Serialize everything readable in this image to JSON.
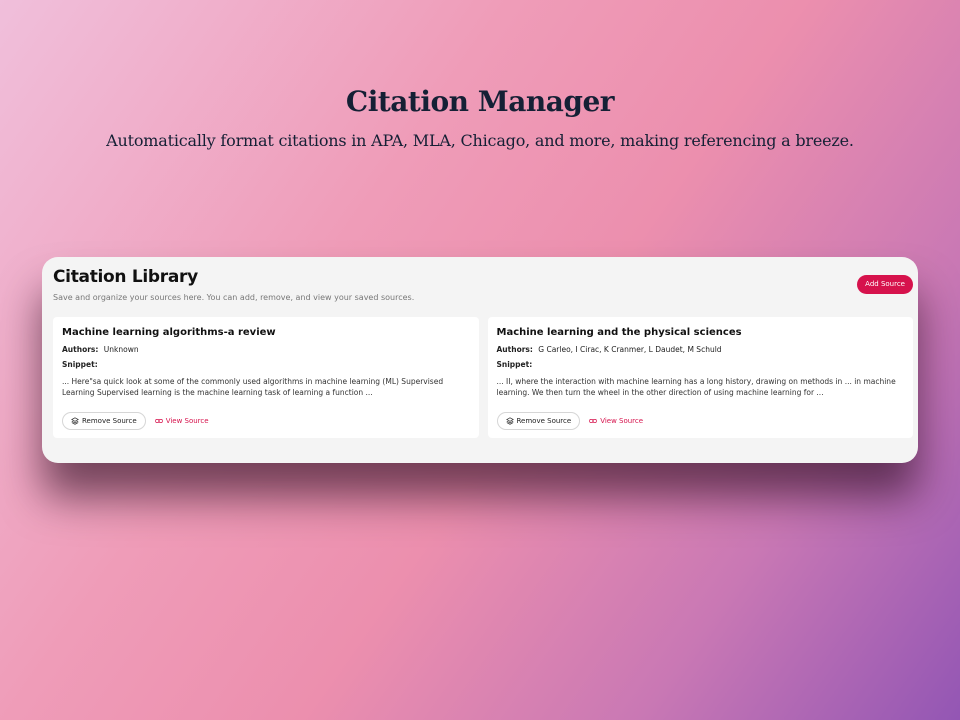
{
  "hero": {
    "title": "Citation Manager",
    "subtitle": "Automatically format citations in APA, MLA, Chicago, and more, making referencing a breeze."
  },
  "library": {
    "title": "Citation Library",
    "description": "Save and organize your sources here. You can add, remove, and view your saved sources.",
    "add_button": "Add Source",
    "authors_label": "Authors:",
    "snippet_label": "Snippet:",
    "remove_label": "Remove Source",
    "view_label": "View Source",
    "sources": [
      {
        "title": "Machine learning algorithms-a review",
        "authors": "Unknown",
        "snippet": "... Here\"sa quick look at some of the commonly used algorithms in machine learning (ML) Supervised Learning Supervised learning is the machine learning task of learning a function ..."
      },
      {
        "title": "Machine learning and the physical sciences",
        "authors": "G Carleo, I Cirac, K Cranmer, L Daudet, M Schuld",
        "snippet": "... II, where the interaction with machine learning has a long history, drawing on methods in ... in machine learning. We then turn the wheel in the other direction of using machine learning for ..."
      }
    ]
  },
  "colors": {
    "accent": "#d6124c",
    "heading": "#152035",
    "panel_bg": "#f4f4f4"
  },
  "icons": {
    "remove": "layers-icon",
    "view": "link-icon"
  }
}
